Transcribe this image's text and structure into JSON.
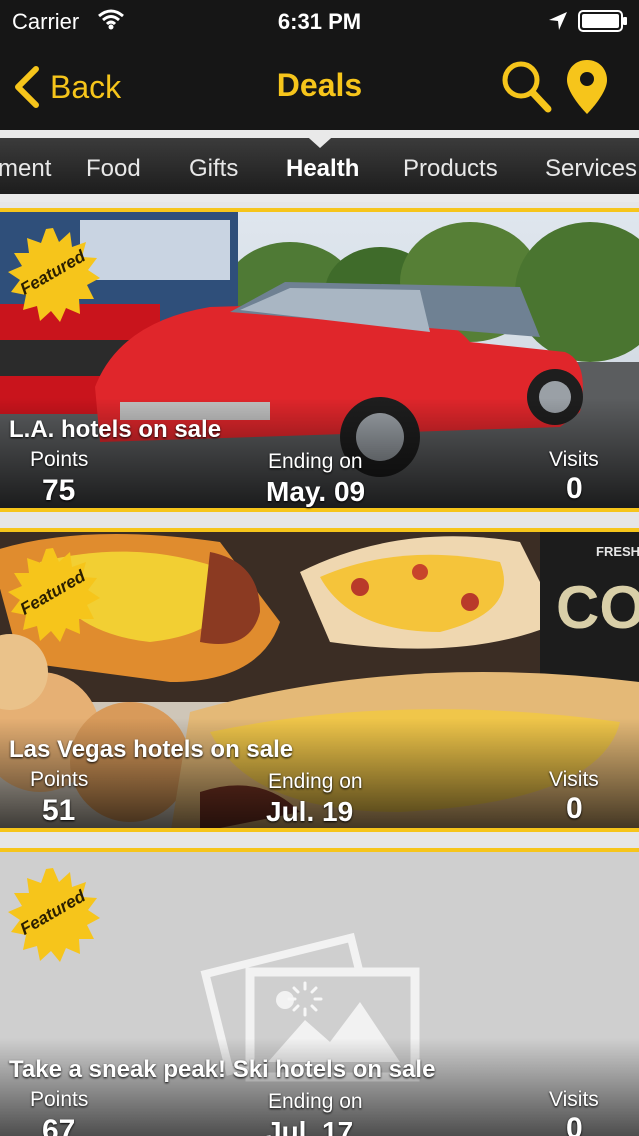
{
  "status_bar": {
    "carrier": "Carrier",
    "time": "6:31 PM"
  },
  "nav": {
    "back_label": "Back",
    "title": "Deals"
  },
  "tabs": [
    "ment",
    "Food",
    "Gifts",
    "Health",
    "Products",
    "Services"
  ],
  "active_tab": "Health",
  "labels": {
    "points": "Points",
    "ending": "Ending on",
    "visits": "Visits",
    "featured": "Featured"
  },
  "colors": {
    "accent": "#f6c51b",
    "nav_bg": "#161616",
    "tab_bg": "#2a2a2a"
  },
  "deals": [
    {
      "title": "L.A. hotels on sale",
      "points": "75",
      "ending": "May. 09",
      "visits": "0",
      "featured": true,
      "image": "red-car-photo"
    },
    {
      "title": "Las Vegas hotels on sale",
      "points": "51",
      "ending": "Jul. 19",
      "visits": "0",
      "featured": true,
      "image": "breakfast-food-photo"
    },
    {
      "title": "Take a sneak peak! Ski hotels on sale",
      "points": "67",
      "ending": "Jul. 17",
      "visits": "0",
      "featured": true,
      "image": "image-placeholder-loading"
    }
  ]
}
